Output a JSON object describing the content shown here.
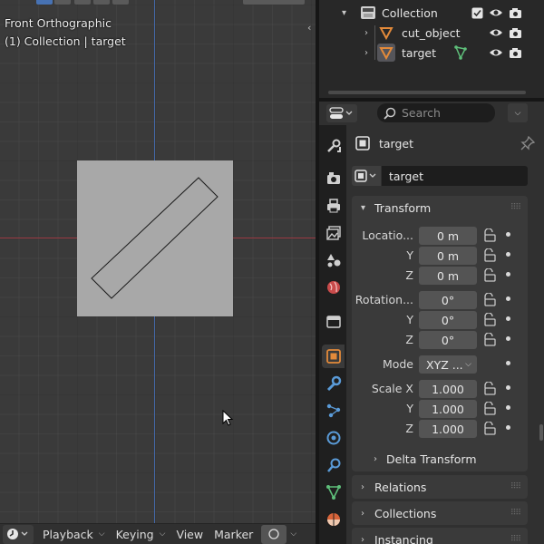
{
  "viewport": {
    "view_name": "Front Orthographic",
    "context": "(1) Collection | target"
  },
  "timeline": {
    "playback": "Playback",
    "keying": "Keying",
    "view": "View",
    "marker": "Marker"
  },
  "outliner": {
    "collection": "Collection",
    "objects": [
      "cut_object",
      "target"
    ]
  },
  "properties": {
    "search_placeholder": "Search",
    "object_name": "target",
    "data_name": "target",
    "transform": {
      "title": "Transform",
      "location_label": "Locatio...",
      "location": [
        "0 m",
        "0 m",
        "0 m"
      ],
      "rotation_label": "Rotation...",
      "rotation": [
        "0°",
        "0°",
        "0°"
      ],
      "mode_label": "Mode",
      "mode_value": "XYZ ...",
      "scale_label": "Scale X",
      "scale": [
        "1.000",
        "1.000",
        "1.000"
      ],
      "axis_y": "Y",
      "axis_z": "Z",
      "delta": "Delta Transform"
    },
    "panels": [
      "Relations",
      "Collections",
      "Instancing"
    ]
  },
  "colors": {
    "accent_blue": "#4772b3",
    "object_orange": "#e38a3a",
    "data_green": "#5ebf7a",
    "axis_red": "#9b3b44",
    "axis_blue": "#4468a8"
  }
}
